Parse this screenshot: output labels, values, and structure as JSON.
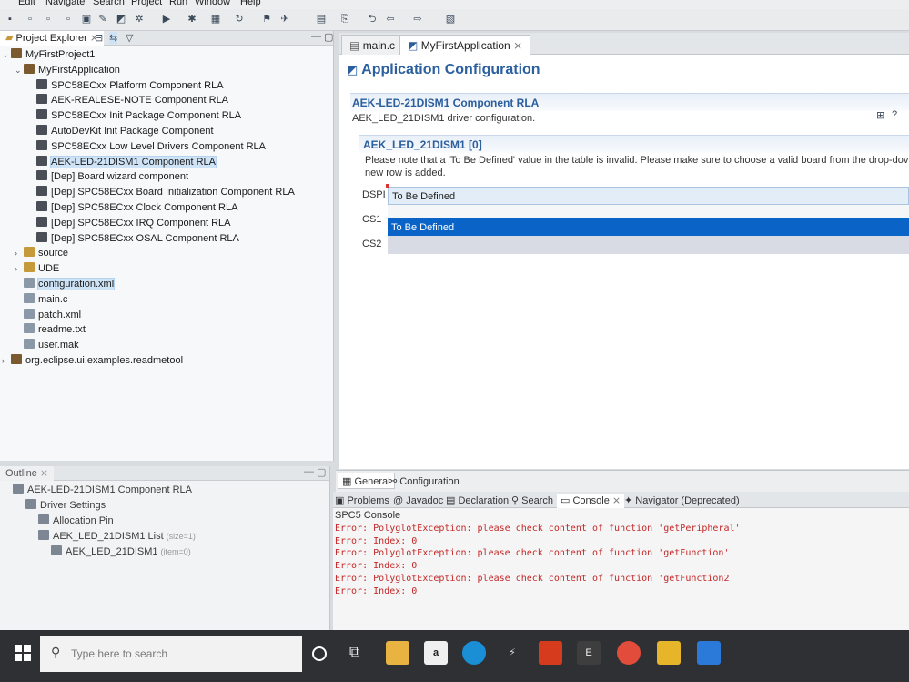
{
  "menu": [
    "Edit",
    "Navigate",
    "Search",
    "Project",
    "Run",
    "Window",
    "Help"
  ],
  "explorer": {
    "tab_label": "Project Explorer",
    "tree": [
      {
        "label": "MyFirstProject1",
        "indent": 0,
        "twisty": "v",
        "icon": "proj"
      },
      {
        "label": "MyFirstApplication",
        "indent": 1,
        "twisty": "v",
        "icon": "proj"
      },
      {
        "label": "SPC58ECxx Platform Component RLA",
        "indent": 2,
        "icon": "comp"
      },
      {
        "label": "AEK-REALESE-NOTE Component RLA",
        "indent": 2,
        "icon": "comp"
      },
      {
        "label": "SPC58ECxx Init Package Component RLA",
        "indent": 2,
        "icon": "comp"
      },
      {
        "label": "AutoDevKit Init Package Component",
        "indent": 2,
        "icon": "comp"
      },
      {
        "label": "SPC58ECxx Low Level Drivers Component RLA",
        "indent": 2,
        "icon": "comp"
      },
      {
        "label": "AEK-LED-21DISM1 Component RLA",
        "indent": 2,
        "icon": "comp",
        "selected": true
      },
      {
        "label": "[Dep] Board wizard component",
        "indent": 2,
        "icon": "comp"
      },
      {
        "label": "[Dep] SPC58ECxx Board Initialization Component RLA",
        "indent": 2,
        "icon": "comp"
      },
      {
        "label": "[Dep] SPC58ECxx Clock Component RLA",
        "indent": 2,
        "icon": "comp"
      },
      {
        "label": "[Dep] SPC58ECxx IRQ Component RLA",
        "indent": 2,
        "icon": "comp"
      },
      {
        "label": "[Dep] SPC58ECxx OSAL Component RLA",
        "indent": 2,
        "icon": "comp"
      },
      {
        "label": "source",
        "indent": 1,
        "twisty": ">",
        "icon": "folder"
      },
      {
        "label": "UDE",
        "indent": 1,
        "twisty": ">",
        "icon": "folder"
      },
      {
        "label": "configuration.xml",
        "indent": 1,
        "icon": "file",
        "selected": true
      },
      {
        "label": "main.c",
        "indent": 1,
        "icon": "file"
      },
      {
        "label": "patch.xml",
        "indent": 1,
        "icon": "file"
      },
      {
        "label": "readme.txt",
        "indent": 1,
        "icon": "file"
      },
      {
        "label": "user.mak",
        "indent": 1,
        "icon": "file"
      },
      {
        "label": "org.eclipse.ui.examples.readmetool",
        "indent": 0,
        "twisty": ">",
        "icon": "proj"
      }
    ]
  },
  "outline": {
    "tab_label": "Outline",
    "tree": [
      {
        "label": "AEK-LED-21DISM1 Component RLA",
        "indent": 0
      },
      {
        "label": "Driver Settings",
        "indent": 1
      },
      {
        "label": "Allocation Pin",
        "indent": 2
      },
      {
        "label": "AEK_LED_21DISM1 List",
        "suffix": "(size=1)",
        "indent": 2
      },
      {
        "label": "AEK_LED_21DISM1",
        "suffix": "(item=0)",
        "indent": 3
      }
    ]
  },
  "editor": {
    "tabs": [
      "main.c",
      "MyFirstApplication"
    ],
    "title": "Application Configuration",
    "section_title": "AEK-LED-21DISM1 Component RLA",
    "section_desc": "AEK_LED_21DISM1 driver configuration.",
    "subsection_title": "AEK_LED_21DISM1 [0]",
    "note_line1": "Please note that a 'To Be Defined' value in the table is invalid. Please make sure to choose a valid board from the drop-dov",
    "note_line2": "new row is added.",
    "fields": [
      {
        "label": "DSPI",
        "value": "To Be Defined"
      },
      {
        "label": "CS1",
        "value": ""
      },
      {
        "label": "CS2",
        "value": ""
      }
    ],
    "dropdown_option": "To Be Defined",
    "bottom_tabs": [
      "General",
      "Configuration"
    ]
  },
  "console": {
    "tabs": [
      "Problems",
      "Javadoc",
      "Declaration",
      "Search",
      "Console",
      "Navigator (Deprecated)"
    ],
    "title": "SPC5 Console",
    "lines": [
      "Error: PolyglotException: please check content of function 'getPeripheral'",
      "Error: Index: 0",
      "Error: PolyglotException: please check content of function 'getFunction'",
      "Error: Index: 0",
      "Error: PolyglotException: please check content of function 'getFunction2'",
      "Error: Index: 0"
    ]
  },
  "taskbar": {
    "search_placeholder": "Type here to search",
    "apps": [
      "task-view",
      "file-explorer",
      "amazon",
      "edge",
      "vs-code",
      "office",
      "edge-beta",
      "chrome",
      "notes",
      "mail"
    ]
  },
  "colors": {
    "accent": "#2b5f9e",
    "selection": "#0a64c8",
    "error": "#c32828"
  }
}
